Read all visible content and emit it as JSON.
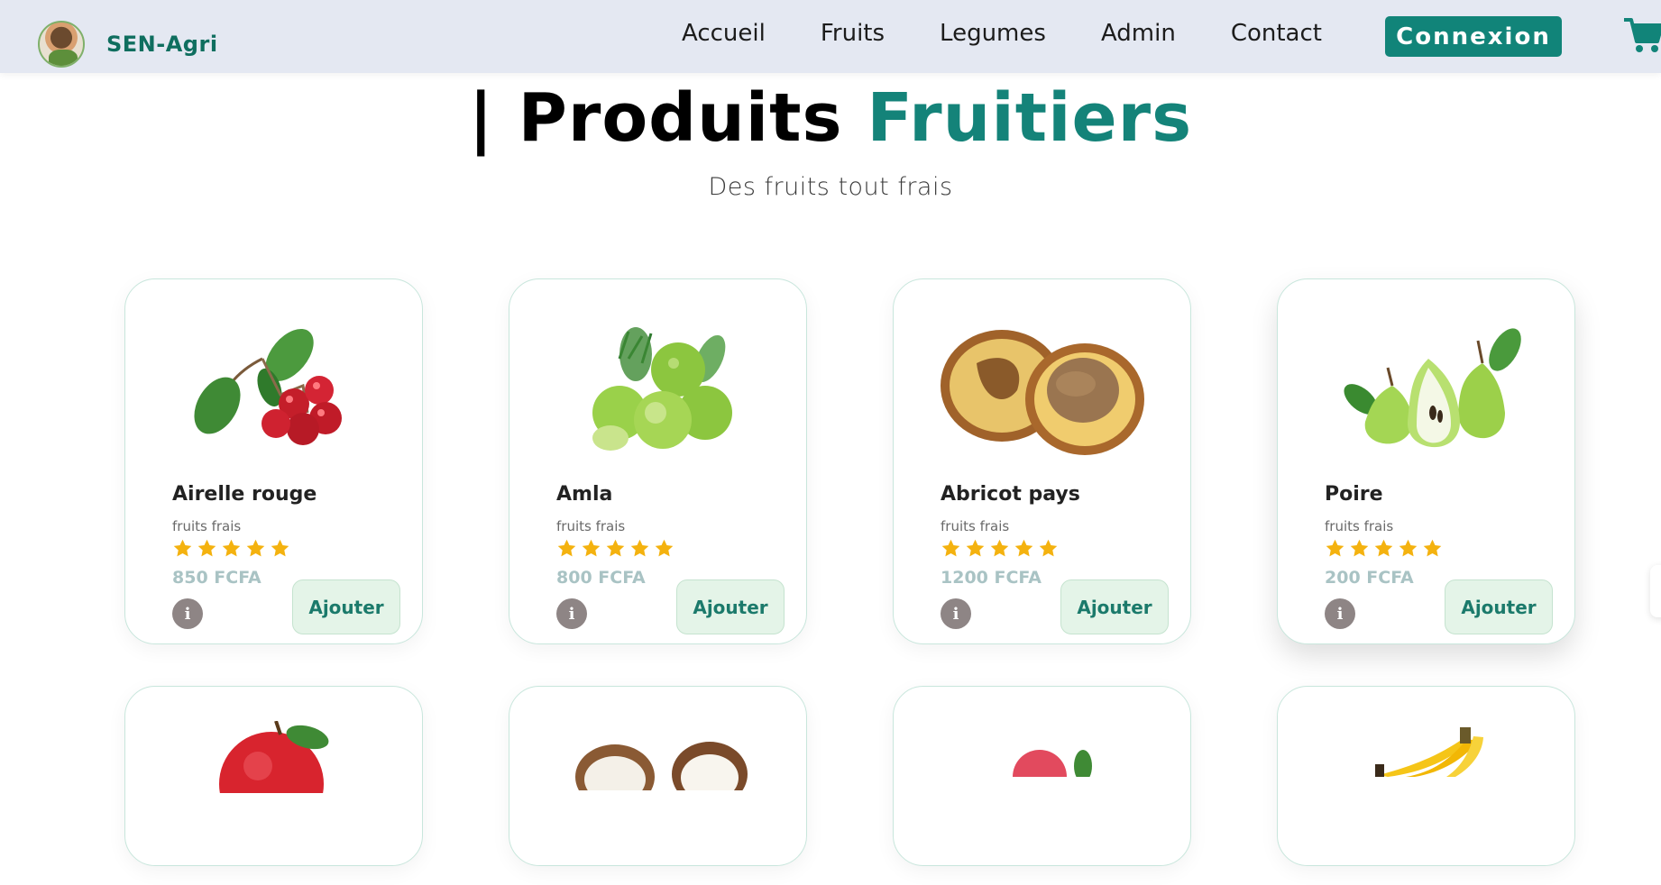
{
  "brand": {
    "name": "SEN-Agri",
    "logo_icon": "farmer-avatar-logo"
  },
  "nav": {
    "links": [
      "Accueil",
      "Fruits",
      "Legumes",
      "Admin",
      "Contact"
    ],
    "login_label": "Connexion",
    "cart_icon": "shopping-cart-icon"
  },
  "heading": {
    "prefix": "| Produits",
    "accent": "Fruitiers",
    "subtitle": "Des fruits tout frais"
  },
  "colors": {
    "brand": "#118479",
    "accent_text": "#148379",
    "nav_bg": "#e4e8f2",
    "star": "#f4b20f",
    "price": "#a9c3c4",
    "add_button_bg": "#e4f4e8"
  },
  "products": [
    {
      "name": "Airelle rouge",
      "category": "fruits frais",
      "rating": 5,
      "price": "850 FCFA",
      "add_label": "Ajouter",
      "image": "red-cranberry-image"
    },
    {
      "name": "Amla",
      "category": "fruits frais",
      "rating": 5,
      "price": "800 FCFA",
      "add_label": "Ajouter",
      "image": "amla-gooseberry-image"
    },
    {
      "name": "Abricot pays",
      "category": "fruits frais",
      "rating": 5,
      "price": "1200 FCFA",
      "add_label": "Ajouter",
      "image": "abricot-pays-image"
    },
    {
      "name": "Poire",
      "category": "fruits frais",
      "rating": 5,
      "price": "200 FCFA",
      "add_label": "Ajouter",
      "image": "pear-image"
    }
  ],
  "products_row2": [
    {
      "image": "red-apple-image"
    },
    {
      "image": "coconut-image"
    },
    {
      "image": "lychee-image"
    },
    {
      "image": "banana-image"
    }
  ]
}
